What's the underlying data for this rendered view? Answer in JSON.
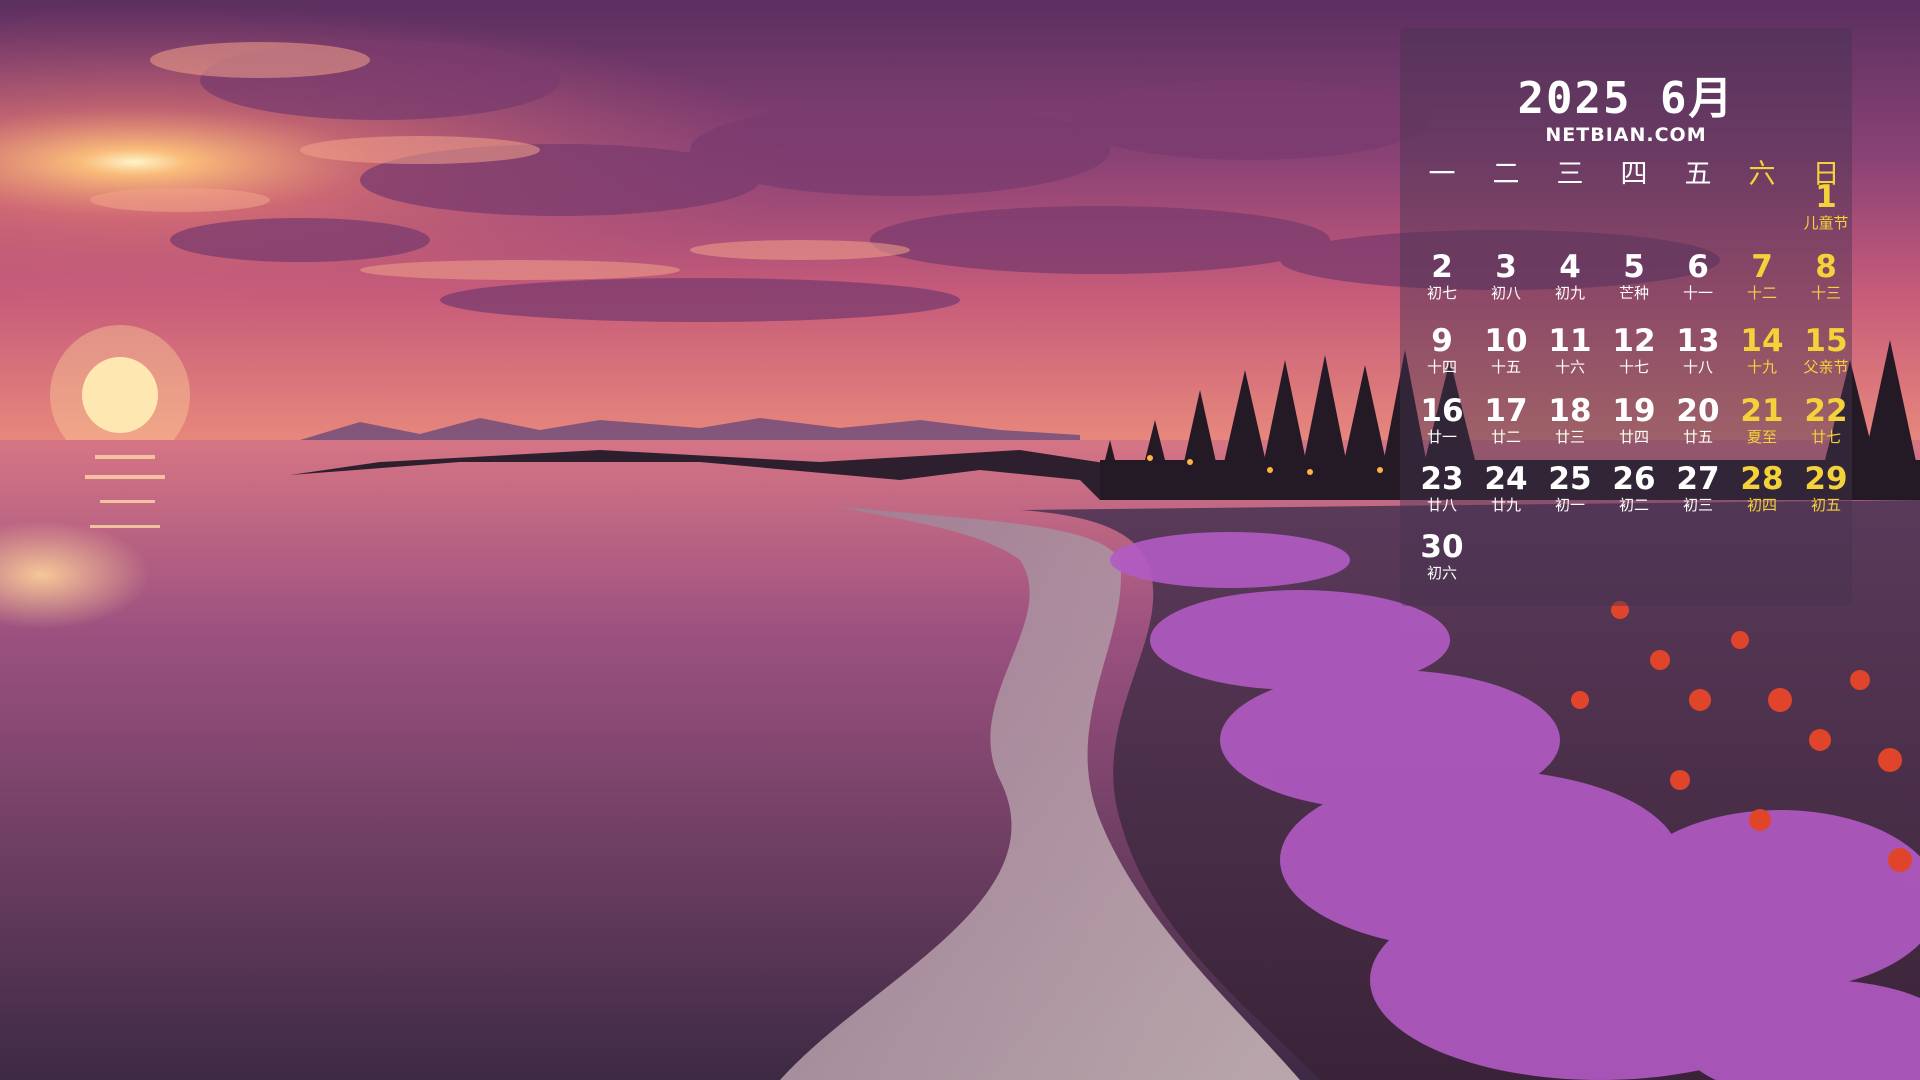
{
  "calendar": {
    "year_month": "2025 6月",
    "site": "NETBIAN.COM",
    "weekdays": [
      {
        "label": "一",
        "weekend": false
      },
      {
        "label": "二",
        "weekend": false
      },
      {
        "label": "三",
        "weekend": false
      },
      {
        "label": "四",
        "weekend": false
      },
      {
        "label": "五",
        "weekend": false
      },
      {
        "label": "六",
        "weekend": true
      },
      {
        "label": "日",
        "weekend": true
      }
    ],
    "weeks": [
      [
        null,
        null,
        null,
        null,
        null,
        null,
        {
          "day": "1",
          "lunar": "儿童节",
          "weekend": true
        }
      ],
      [
        {
          "day": "2",
          "lunar": "初七"
        },
        {
          "day": "3",
          "lunar": "初八"
        },
        {
          "day": "4",
          "lunar": "初九"
        },
        {
          "day": "5",
          "lunar": "芒种"
        },
        {
          "day": "6",
          "lunar": "十一"
        },
        {
          "day": "7",
          "lunar": "十二",
          "weekend": true
        },
        {
          "day": "8",
          "lunar": "十三",
          "weekend": true
        }
      ],
      [
        {
          "day": "9",
          "lunar": "十四"
        },
        {
          "day": "10",
          "lunar": "十五"
        },
        {
          "day": "11",
          "lunar": "十六"
        },
        {
          "day": "12",
          "lunar": "十七"
        },
        {
          "day": "13",
          "lunar": "十八"
        },
        {
          "day": "14",
          "lunar": "十九",
          "weekend": true
        },
        {
          "day": "15",
          "lunar": "父亲节",
          "weekend": true
        }
      ],
      [
        {
          "day": "16",
          "lunar": "廿一"
        },
        {
          "day": "17",
          "lunar": "廿二"
        },
        {
          "day": "18",
          "lunar": "廿三"
        },
        {
          "day": "19",
          "lunar": "廿四"
        },
        {
          "day": "20",
          "lunar": "廿五"
        },
        {
          "day": "21",
          "lunar": "夏至",
          "weekend": true
        },
        {
          "day": "22",
          "lunar": "廿七",
          "weekend": true
        }
      ],
      [
        {
          "day": "23",
          "lunar": "廿八"
        },
        {
          "day": "24",
          "lunar": "廿九"
        },
        {
          "day": "25",
          "lunar": "初一"
        },
        {
          "day": "26",
          "lunar": "初二"
        },
        {
          "day": "27",
          "lunar": "初三"
        },
        {
          "day": "28",
          "lunar": "初四",
          "weekend": true
        },
        {
          "day": "29",
          "lunar": "初五",
          "weekend": true
        }
      ],
      [
        {
          "day": "30",
          "lunar": "初六"
        },
        null,
        null,
        null,
        null,
        null,
        null
      ]
    ]
  },
  "colors": {
    "weekend": "#f4d23a",
    "text": "#ffffff",
    "sky_top": "#6b3a6e",
    "sky_glow": "#f07a6a",
    "water": "#8a4f7a",
    "flowers": "#b25bc4",
    "poppies": "#e0452b"
  }
}
